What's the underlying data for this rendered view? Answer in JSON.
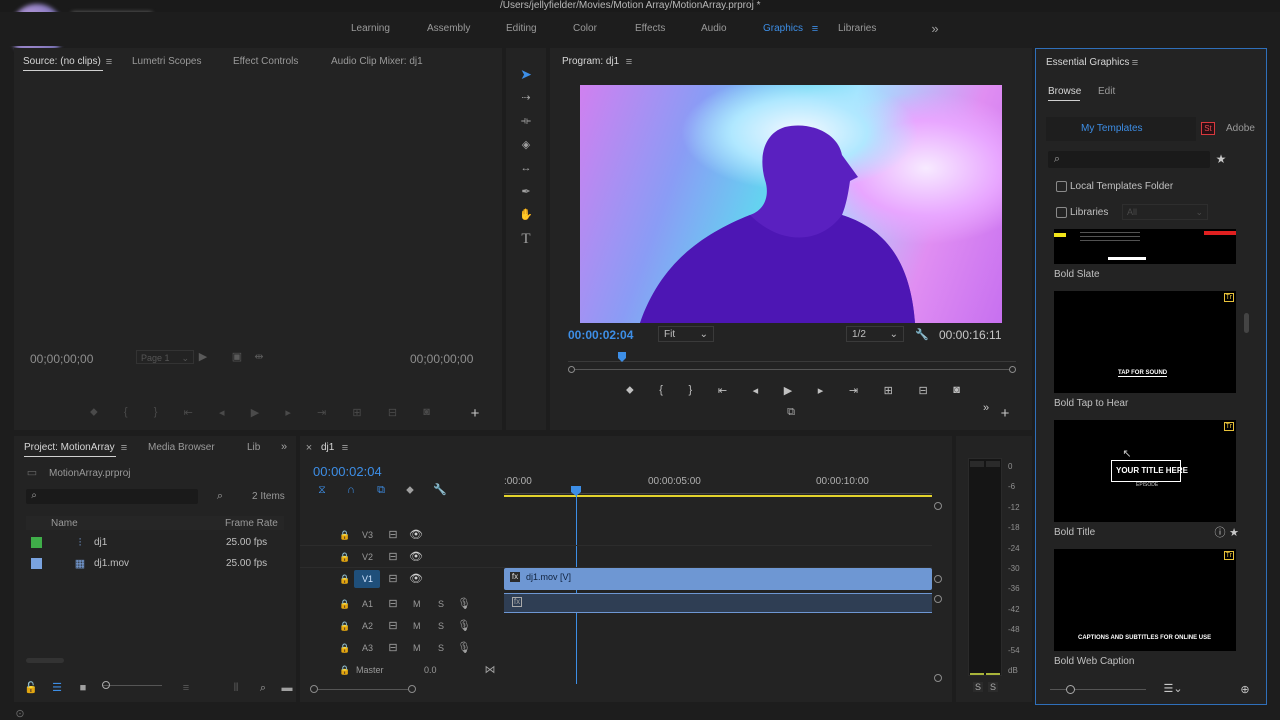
{
  "titlebar": {
    "path": "/Users/jellyfielder/Movies/Motion Array/MotionArray.prproj *"
  },
  "workspaces": {
    "items": [
      "Learning",
      "Assembly",
      "Editing",
      "Color",
      "Effects",
      "Audio",
      "Graphics",
      "Libraries"
    ],
    "active": "Graphics",
    "more": "»"
  },
  "source": {
    "tabs": [
      "Source: (no clips)",
      "Lumetri Scopes",
      "Effect Controls",
      "Audio Clip Mixer: dj1"
    ],
    "tc_left": "00;00;00;00",
    "tc_right": "00;00;00;00",
    "page": "Page 1"
  },
  "program": {
    "title": "Program: dj1",
    "timecode": "00:00:02:04",
    "fit": "Fit",
    "resolution": "1/2",
    "duration": "00:00:16:11"
  },
  "project": {
    "tabs": [
      "Project: MotionArray",
      "Media Browser",
      "Lib"
    ],
    "file": "MotionArray.prproj",
    "count": "2 Items",
    "col_name": "Name",
    "col_rate": "Frame Rate",
    "rows": [
      {
        "name": "dj1",
        "rate": "25.00 fps",
        "color": "#3fae49"
      },
      {
        "name": "dj1.mov",
        "rate": "25.00 fps",
        "color": "#7aa3df"
      }
    ]
  },
  "timeline": {
    "tab": "dj1",
    "timecode": "00:00:02:04",
    "ruler": [
      ":00:00",
      "00:00:05:00",
      "00:00:10:00"
    ],
    "video_tracks": [
      "V3",
      "V2",
      "V1"
    ],
    "audio_tracks": [
      "A1",
      "A2",
      "A3"
    ],
    "master": "Master",
    "master_val": "0.0",
    "clip": "dj1.mov [V]",
    "m": "M",
    "s": "S"
  },
  "meter": {
    "scale": [
      "0",
      "-6",
      "-12",
      "-18",
      "-24",
      "-30",
      "-36",
      "-42",
      "-48",
      "-54",
      "dB"
    ],
    "solo": "S"
  },
  "eg": {
    "title": "Essential Graphics",
    "tabs": [
      "Browse",
      "Edit"
    ],
    "my_templates": "My Templates",
    "adobe": "Adobe",
    "st_badge": "St",
    "local": "Local Templates Folder",
    "libraries": "Libraries",
    "lib_sel": "All",
    "templates": [
      {
        "name": "Bold Slate"
      },
      {
        "name": "Bold Tap to Hear",
        "text": "TAP FOR SOUND"
      },
      {
        "name": "Bold Title",
        "text": "YOUR TITLE HERE",
        "sub": "EPISODE"
      },
      {
        "name": "Bold Web Caption",
        "text": "CAPTIONS AND SUBTITLES FOR ONLINE USE"
      }
    ],
    "tr_badge": "Tr"
  },
  "colors": {
    "accent": "#3d8ee6",
    "clip": "#6e97d3",
    "workarea": "#e3d32c"
  }
}
